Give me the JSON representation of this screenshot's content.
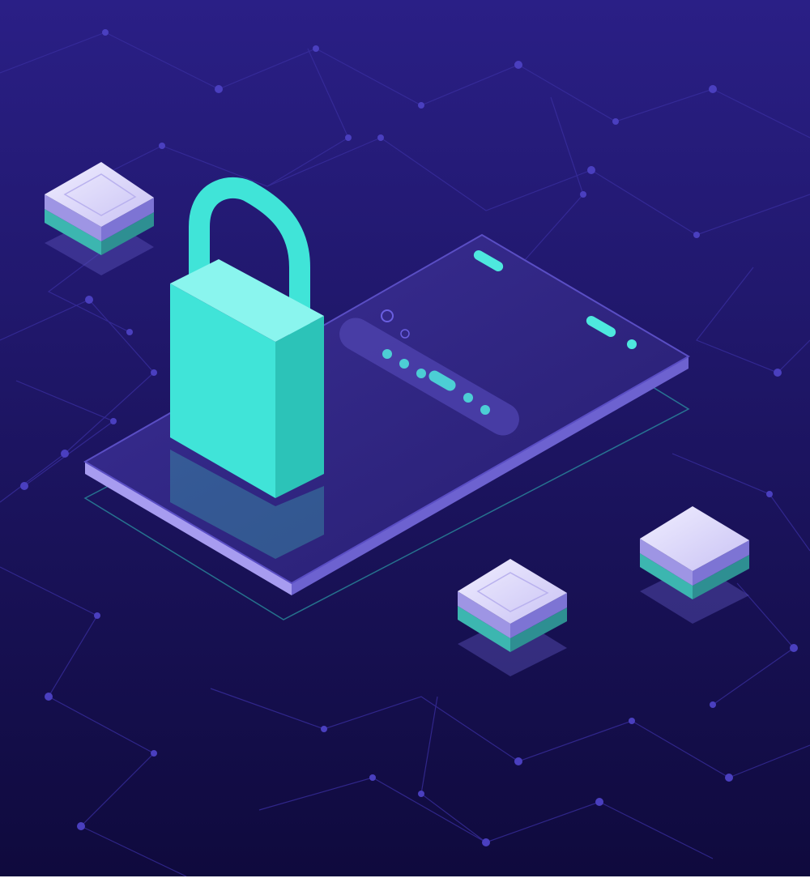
{
  "illustration": {
    "subject": "isometric-smartphone-with-padlock",
    "icons": [
      "padlock-icon",
      "smartphone-icon",
      "password-field-icon",
      "chip-tile-icon",
      "network-mesh-icon"
    ],
    "colors": {
      "background_top": "#2a1f86",
      "background_bottom": "#0f0a3d",
      "network_line": "#3a2fa0",
      "network_node": "#4a3fbf",
      "phone_screen": "#2d247a",
      "phone_edge": "#a79cf0",
      "phone_edge_dark": "#6d62d0",
      "accent_teal": "#4ee8de",
      "lock_body": "#40e4d8",
      "lock_body_side": "#2cc3b8",
      "tile_top": "#e0dcfa",
      "tile_side": "#9e95e4",
      "tile_base": "#3cb6b0"
    },
    "password_field": {
      "dots_count": 6
    },
    "floating_tiles_count": 3
  }
}
